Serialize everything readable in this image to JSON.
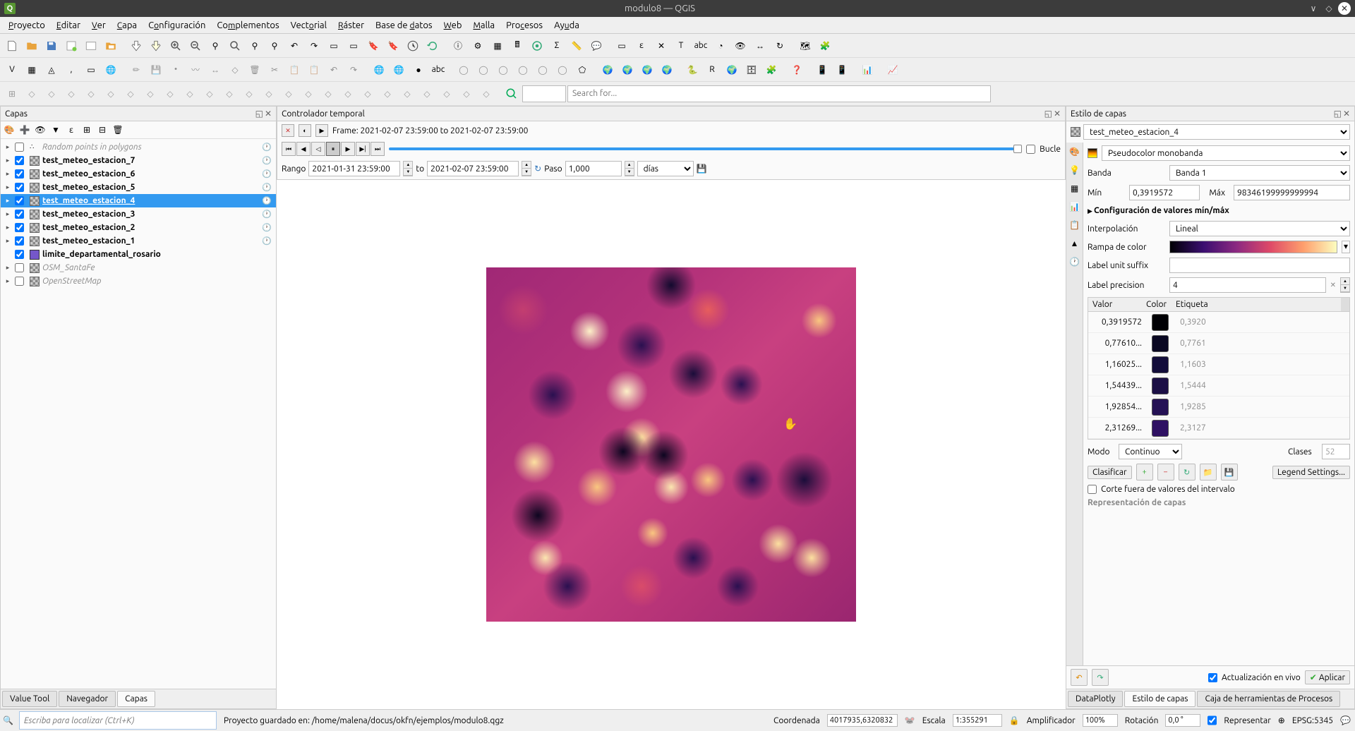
{
  "window": {
    "title": "modulo8 — QGIS"
  },
  "menu": [
    "Proyecto",
    "Editar",
    "Ver",
    "Capa",
    "Configuración",
    "Complementos",
    "Vectorial",
    "Ráster",
    "Base de datos",
    "Web",
    "Malla",
    "Procesos",
    "Ayuda"
  ],
  "search": {
    "placeholder": "Search for..."
  },
  "locator": {
    "placeholder": "Escriba para localizar (Ctrl+K)"
  },
  "panels": {
    "layers_title": "Capas",
    "temporal_title": "Controlador temporal",
    "style_title": "Estilo de capas"
  },
  "layers": [
    {
      "name": "Random points in polygons",
      "checked": false,
      "italic": true,
      "clock": true,
      "icon": "points"
    },
    {
      "name": "test_meteo_estacion_7",
      "checked": true,
      "clock": true,
      "icon": "raster"
    },
    {
      "name": "test_meteo_estacion_6",
      "checked": true,
      "clock": true,
      "icon": "raster"
    },
    {
      "name": "test_meteo_estacion_5",
      "checked": true,
      "clock": true,
      "icon": "raster"
    },
    {
      "name": "test_meteo_estacion_4",
      "checked": true,
      "clock": true,
      "icon": "raster",
      "selected": true
    },
    {
      "name": "test_meteo_estacion_3",
      "checked": true,
      "clock": true,
      "icon": "raster"
    },
    {
      "name": "test_meteo_estacion_2",
      "checked": true,
      "clock": true,
      "icon": "raster"
    },
    {
      "name": "test_meteo_estacion_1",
      "checked": true,
      "clock": true,
      "icon": "raster"
    },
    {
      "name": "limite_departamental_rosario",
      "checked": true,
      "clock": false,
      "icon": "poly",
      "noexpand": true
    },
    {
      "name": "OSM_SantaFe",
      "checked": false,
      "clock": false,
      "icon": "raster"
    },
    {
      "name": "OpenStreetMap",
      "checked": false,
      "italic": true,
      "clock": false,
      "icon": "raster"
    }
  ],
  "bottom_tabs": {
    "value_tool": "Value Tool",
    "navegador": "Navegador",
    "capas": "Capas"
  },
  "temporal": {
    "frame": "Frame: 2021-02-07 23:59:00 to 2021-02-07 23:59:00",
    "bucle": "Bucle",
    "rango_label": "Rango",
    "start": "2021-01-31 23:59:00",
    "to": "to",
    "end": "2021-02-07 23:59:00",
    "paso_label": "Paso",
    "paso_value": "1,000",
    "unit": "días"
  },
  "style": {
    "layer_select": "test_meteo_estacion_4",
    "renderer": "Pseudocolor monobanda",
    "banda_label": "Banda",
    "banda_value": "Banda 1",
    "min_label": "Mín",
    "min_value": "0,3919572",
    "max_label": "Máx",
    "max_value": "98346199999999994",
    "config_minmax": "Configuración de valores mín/máx",
    "interp_label": "Interpolación",
    "interp_value": "Lineal",
    "ramp_label": "Rampa de color",
    "suffix_label": "Label unit suffix",
    "precision_label": "Label precision",
    "precision_value": "4",
    "table_headers": {
      "valor": "Valor",
      "color": "Color",
      "etiqueta": "Etiqueta"
    },
    "classes": [
      {
        "value": "0,3919572",
        "color": "#000004",
        "label": "0,3920"
      },
      {
        "value": "0,77610...",
        "color": "#0a0822",
        "label": "0,7761"
      },
      {
        "value": "1,16025...",
        "color": "#130d3a",
        "label": "1,1603"
      },
      {
        "value": "1,54439...",
        "color": "#1c1046",
        "label": "1,5444"
      },
      {
        "value": "1,92854...",
        "color": "#251255",
        "label": "1,9285"
      },
      {
        "value": "2,31269...",
        "color": "#2f1163",
        "label": "2,3127"
      }
    ],
    "modo_label": "Modo",
    "modo_value": "Continuo",
    "clases_label": "Clases",
    "clases_value": "52",
    "clasificar": "Clasificar",
    "legend_settings": "Legend Settings...",
    "corte": "Corte fuera de valores del intervalo",
    "repr_capas": "Representación de capas",
    "live_update": "Actualización en vivo",
    "aplicar": "Aplicar"
  },
  "right_tabs": {
    "dataplotly": "DataPlotly",
    "estilo": "Estilo de capas",
    "caja": "Caja de herramientas de Procesos"
  },
  "statusbar": {
    "msg": "Proyecto guardado en: /home/malena/docus/okfn/ejemplos/modulo8.qgz",
    "coord_label": "Coordenada",
    "coord": "4017935,6320832",
    "escala_label": "Escala",
    "escala": "1:355291",
    "amp_label": "Amplificador",
    "amp": "100%",
    "rot_label": "Rotación",
    "rot": "0,0 °",
    "repr": "Representar",
    "epsg": "EPSG:5345"
  }
}
